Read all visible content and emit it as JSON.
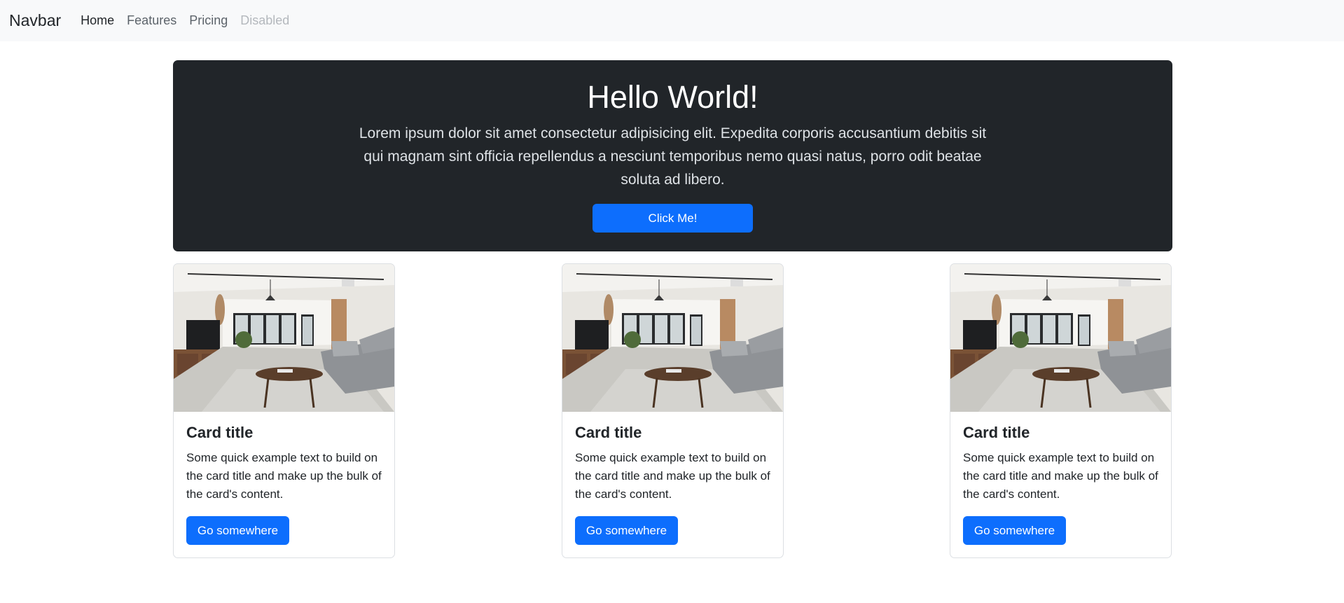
{
  "navbar": {
    "brand": "Navbar",
    "links": [
      {
        "label": "Home",
        "state": "active"
      },
      {
        "label": "Features",
        "state": "default"
      },
      {
        "label": "Pricing",
        "state": "default"
      },
      {
        "label": "Disabled",
        "state": "disabled"
      }
    ]
  },
  "hero": {
    "title": "Hello World!",
    "text": "Lorem ipsum dolor sit amet consectetur adipisicing elit. Expedita corporis accusantium debitis sit qui magnam sint officia repellendus a nesciunt temporibus nemo quasi natus, porro odit beatae soluta ad libero.",
    "button_label": "Click Me!"
  },
  "cards": [
    {
      "image": "living-room-photo",
      "title": "Card title",
      "text": "Some quick example text to build on the card title and make up the bulk of the card's content.",
      "button_label": "Go somewhere"
    },
    {
      "image": "living-room-photo",
      "title": "Card title",
      "text": "Some quick example text to build on the card title and make up the bulk of the card's content.",
      "button_label": "Go somewhere"
    },
    {
      "image": "living-room-photo",
      "title": "Card title",
      "text": "Some quick example text to build on the card title and make up the bulk of the card's content.",
      "button_label": "Go somewhere"
    }
  ],
  "colors": {
    "primary": "#0d6efd",
    "dark": "#212529",
    "navbar_bg": "#f8f9fa"
  }
}
